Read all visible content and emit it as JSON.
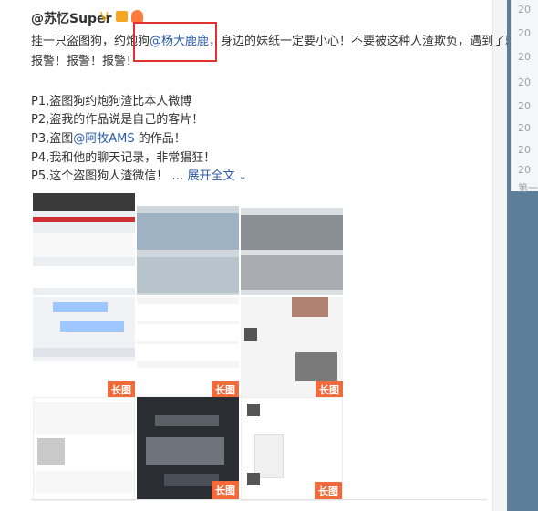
{
  "post": {
    "username": "@苏忆Super",
    "badge_v": "V",
    "line1_a": "挂一只盗图狗，约炮狗",
    "line1_mention": "@杨大鹿鹿，",
    "line1_b": "身边的妹纸一定要小心！不要被这种人渣欺负，遇到了就",
    "line2": "报警！报警！报警！",
    "p1": "P1,盗图狗约炮狗渣比本人微博",
    "p2": "P2,盗我的作品说是自己的客片！",
    "p3_a": "P3,盗图",
    "p3_mention": "@阿牧AMS",
    "p3_b": " 的作品！",
    "p4": "P4,我和他的聊天记录，非常猖狂！",
    "p5": "P5,这个盗图狗人渣微信！ … ",
    "expand": "展开全文",
    "expand_icon": "chevron-down-icon"
  },
  "thumbnails": [
    {
      "tag": ""
    },
    {
      "tag": ""
    },
    {
      "tag": ""
    },
    {
      "tag": "长图"
    },
    {
      "tag": "长图"
    },
    {
      "tag": "长图"
    },
    {
      "tag": ""
    },
    {
      "tag": "长图"
    },
    {
      "tag": "长图"
    }
  ],
  "sidebar": {
    "items": [
      "20",
      "20",
      "20",
      "20",
      "20",
      "20",
      "20",
      "20",
      "第一"
    ]
  },
  "colors": {
    "mention": "#2a5ba5",
    "highlight_box": "#e03030",
    "tag_bg": "#f26a3a"
  }
}
